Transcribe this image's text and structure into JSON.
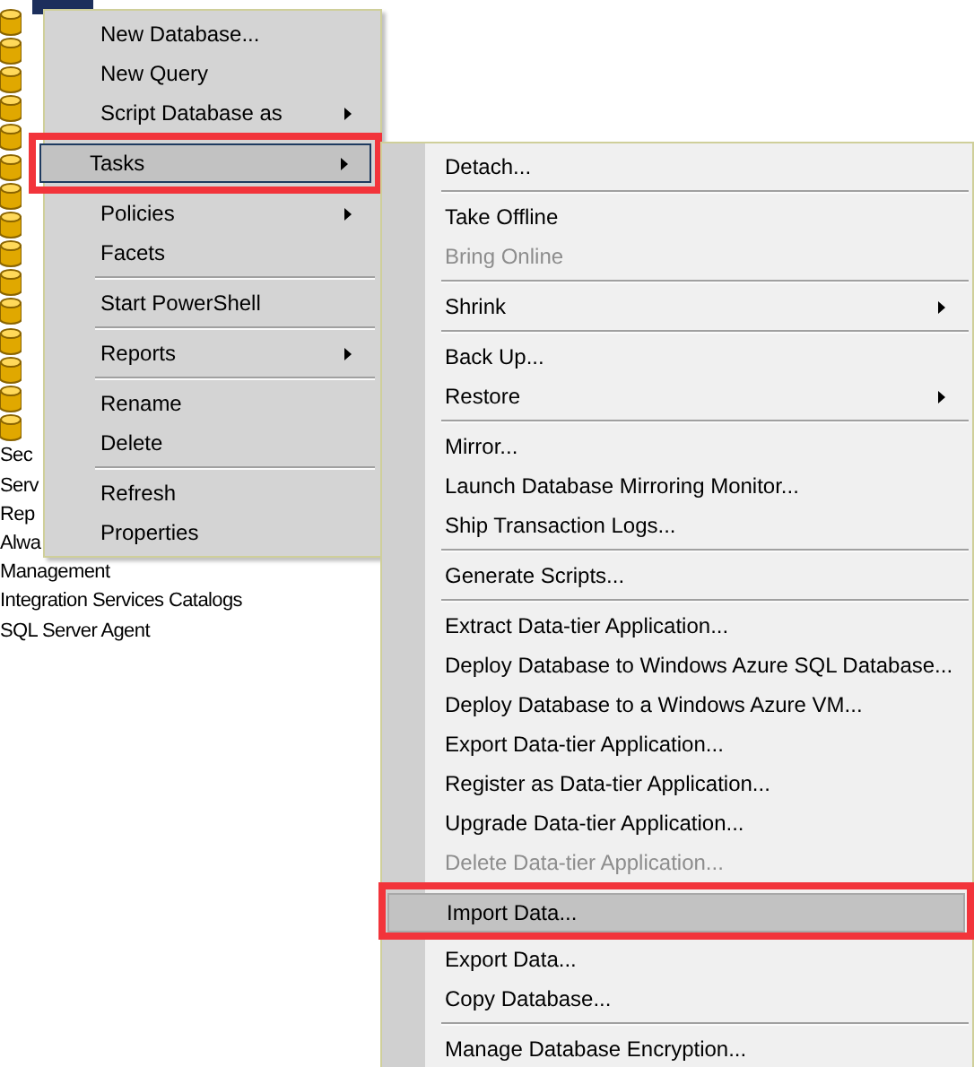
{
  "tree": {
    "selected_node": true,
    "items": [
      {
        "label": "Sec"
      },
      {
        "label": "Serv"
      },
      {
        "label": "Rep"
      },
      {
        "label": "Alwa"
      },
      {
        "label": "Management"
      },
      {
        "label": "Integration Services Catalogs"
      },
      {
        "label": "SQL Server Agent"
      }
    ]
  },
  "context_menu": {
    "items": [
      {
        "kind": "item",
        "label": "New Database...",
        "submenu": false,
        "selected": false,
        "annotated": false
      },
      {
        "kind": "item",
        "label": "New Query",
        "submenu": false,
        "selected": false,
        "annotated": false
      },
      {
        "kind": "item",
        "label": "Script Database as",
        "submenu": true,
        "selected": false,
        "annotated": false
      },
      {
        "kind": "separator"
      },
      {
        "kind": "item",
        "label": "Tasks",
        "submenu": true,
        "selected": true,
        "annotated": true
      },
      {
        "kind": "separator"
      },
      {
        "kind": "item",
        "label": "Policies",
        "submenu": true,
        "selected": false,
        "annotated": false
      },
      {
        "kind": "item",
        "label": "Facets",
        "submenu": false,
        "selected": false,
        "annotated": false
      },
      {
        "kind": "separator"
      },
      {
        "kind": "item",
        "label": "Start PowerShell",
        "submenu": false,
        "selected": false,
        "annotated": false
      },
      {
        "kind": "separator"
      },
      {
        "kind": "item",
        "label": "Reports",
        "submenu": true,
        "selected": false,
        "annotated": false
      },
      {
        "kind": "separator"
      },
      {
        "kind": "item",
        "label": "Rename",
        "submenu": false,
        "selected": false,
        "annotated": false
      },
      {
        "kind": "item",
        "label": "Delete",
        "submenu": false,
        "selected": false,
        "annotated": false
      },
      {
        "kind": "separator"
      },
      {
        "kind": "item",
        "label": "Refresh",
        "submenu": false,
        "selected": false,
        "annotated": false
      },
      {
        "kind": "item",
        "label": "Properties",
        "submenu": false,
        "selected": false,
        "annotated": false
      }
    ]
  },
  "tasks_submenu": {
    "items": [
      {
        "kind": "item",
        "label": "Detach...",
        "submenu": false,
        "selected": false,
        "disabled": false,
        "annotated": false
      },
      {
        "kind": "separator"
      },
      {
        "kind": "item",
        "label": "Take Offline",
        "submenu": false,
        "selected": false,
        "disabled": false,
        "annotated": false
      },
      {
        "kind": "item",
        "label": "Bring Online",
        "submenu": false,
        "selected": false,
        "disabled": true,
        "annotated": false
      },
      {
        "kind": "separator"
      },
      {
        "kind": "item",
        "label": "Shrink",
        "submenu": true,
        "selected": false,
        "disabled": false,
        "annotated": false
      },
      {
        "kind": "separator"
      },
      {
        "kind": "item",
        "label": "Back Up...",
        "submenu": false,
        "selected": false,
        "disabled": false,
        "annotated": false
      },
      {
        "kind": "item",
        "label": "Restore",
        "submenu": true,
        "selected": false,
        "disabled": false,
        "annotated": false
      },
      {
        "kind": "separator"
      },
      {
        "kind": "item",
        "label": "Mirror...",
        "submenu": false,
        "selected": false,
        "disabled": false,
        "annotated": false
      },
      {
        "kind": "item",
        "label": "Launch Database Mirroring Monitor...",
        "submenu": false,
        "selected": false,
        "disabled": false,
        "annotated": false
      },
      {
        "kind": "item",
        "label": "Ship Transaction Logs...",
        "submenu": false,
        "selected": false,
        "disabled": false,
        "annotated": false
      },
      {
        "kind": "separator"
      },
      {
        "kind": "item",
        "label": "Generate Scripts...",
        "submenu": false,
        "selected": false,
        "disabled": false,
        "annotated": false
      },
      {
        "kind": "separator"
      },
      {
        "kind": "item",
        "label": "Extract Data-tier Application...",
        "submenu": false,
        "selected": false,
        "disabled": false,
        "annotated": false
      },
      {
        "kind": "item",
        "label": "Deploy Database to Windows Azure SQL Database...",
        "submenu": false,
        "selected": false,
        "disabled": false,
        "annotated": false
      },
      {
        "kind": "item",
        "label": "Deploy Database to a Windows Azure VM...",
        "submenu": false,
        "selected": false,
        "disabled": false,
        "annotated": false
      },
      {
        "kind": "item",
        "label": "Export Data-tier Application...",
        "submenu": false,
        "selected": false,
        "disabled": false,
        "annotated": false
      },
      {
        "kind": "item",
        "label": "Register as Data-tier Application...",
        "submenu": false,
        "selected": false,
        "disabled": false,
        "annotated": false
      },
      {
        "kind": "item",
        "label": "Upgrade Data-tier Application...",
        "submenu": false,
        "selected": false,
        "disabled": false,
        "annotated": false
      },
      {
        "kind": "item",
        "label": "Delete Data-tier Application...",
        "submenu": false,
        "selected": false,
        "disabled": true,
        "annotated": false
      },
      {
        "kind": "separator"
      },
      {
        "kind": "item",
        "label": "Import Data...",
        "submenu": false,
        "selected": true,
        "disabled": false,
        "annotated": true
      },
      {
        "kind": "item",
        "label": "Export Data...",
        "submenu": false,
        "selected": false,
        "disabled": false,
        "annotated": false
      },
      {
        "kind": "item",
        "label": "Copy Database...",
        "submenu": false,
        "selected": false,
        "disabled": false,
        "annotated": false
      },
      {
        "kind": "separator"
      },
      {
        "kind": "item",
        "label": "Manage Database Encryption...",
        "submenu": false,
        "selected": false,
        "disabled": false,
        "annotated": false
      }
    ]
  }
}
